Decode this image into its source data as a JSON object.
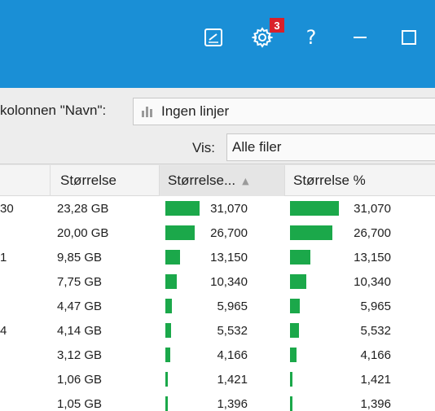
{
  "titlebar": {
    "notification_count": "3",
    "help_label": "?",
    "accent": "#1a8fd6",
    "badge_color": "#d9202a"
  },
  "toolbar": {
    "column_label": "kolonnen \"Navn\":",
    "lines_value": "Ingen linjer",
    "vis_label": "Vis:",
    "vis_value": "Alle filer"
  },
  "table": {
    "bar_color": "#1ba84a",
    "headers": {
      "col0": "",
      "size": "Størrelse",
      "size_graph": "Størrelse...",
      "size_pct": "Størrelse %"
    },
    "rows": [
      {
        "fragment": "30",
        "size": "23,28 GB",
        "graph": "31,070",
        "pct": "31,070",
        "fraction": 1.0
      },
      {
        "fragment": "",
        "size": "20,00 GB",
        "graph": "26,700",
        "pct": "26,700",
        "fraction": 0.859
      },
      {
        "fragment": "1",
        "size": "9,85 GB",
        "graph": "13,150",
        "pct": "13,150",
        "fraction": 0.423
      },
      {
        "fragment": "",
        "size": "7,75 GB",
        "graph": "10,340",
        "pct": "10,340",
        "fraction": 0.333
      },
      {
        "fragment": "",
        "size": "4,47 GB",
        "graph": "5,965",
        "pct": "5,965",
        "fraction": 0.192
      },
      {
        "fragment": "4",
        "size": "4,14 GB",
        "graph": "5,532",
        "pct": "5,532",
        "fraction": 0.178
      },
      {
        "fragment": "",
        "size": "3,12 GB",
        "graph": "4,166",
        "pct": "4,166",
        "fraction": 0.134
      },
      {
        "fragment": "",
        "size": "1,06 GB",
        "graph": "1,421",
        "pct": "1,421",
        "fraction": 0.046
      },
      {
        "fragment": "",
        "size": "1,05 GB",
        "graph": "1,396",
        "pct": "1,396",
        "fraction": 0.045
      }
    ]
  }
}
